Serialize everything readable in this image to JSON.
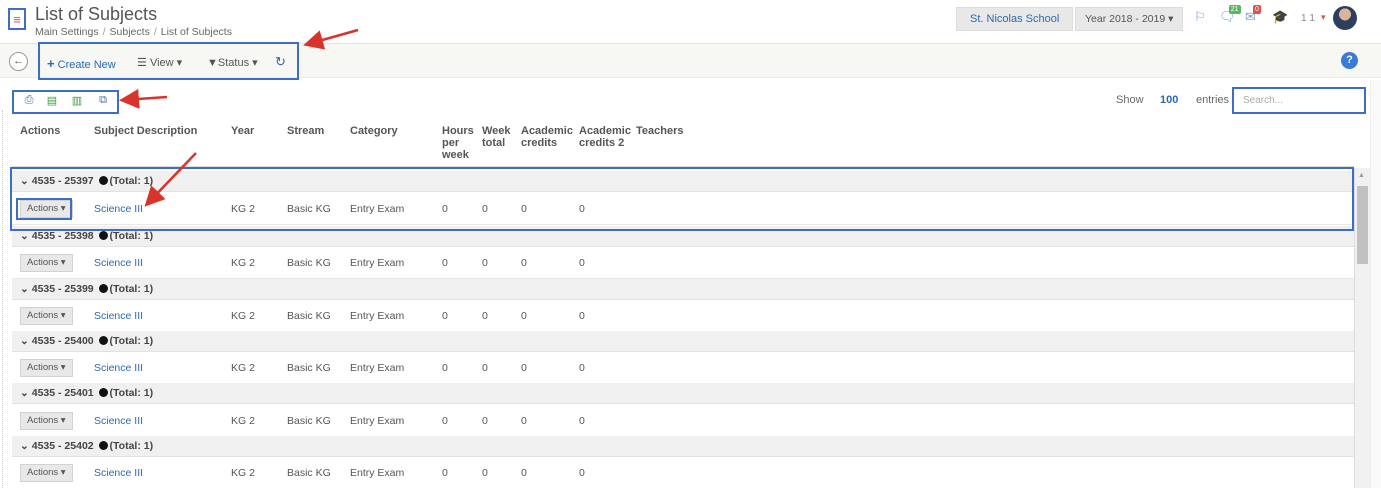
{
  "header": {
    "menu_icon": "hamburger-icon",
    "title": "List of Subjects",
    "breadcrumb": [
      "Main Settings",
      "Subjects",
      "List of Subjects"
    ],
    "school": "St. Nicolas School",
    "year": "Year 2018 - 2019",
    "notifications": {
      "messages_badge": "21",
      "mail_badge": "0"
    },
    "user_count": "1 1"
  },
  "toolbar": {
    "create_new": "Create New",
    "view": "View",
    "status": "Status",
    "help": "?"
  },
  "table_controls": {
    "show_label": "Show",
    "show_value": "100",
    "entries_label": "entries",
    "search_placeholder": "Search..."
  },
  "columns": [
    "Actions",
    "Subject Description",
    "Year",
    "Stream",
    "Category",
    "Hours per week",
    "Week total",
    "Academic credits",
    "Academic credits 2",
    "Teachers"
  ],
  "column_lines": {
    "hours": [
      "Hours",
      "per",
      "week"
    ],
    "week_total": [
      "Week",
      "total"
    ],
    "academic_credits": [
      "Academic",
      "credits"
    ],
    "academic_credits_2": [
      "Academic",
      "credits 2"
    ]
  },
  "groups": [
    {
      "label": "4535 - 25397",
      "total": "(Total: 1)",
      "row": {
        "actions": "Actions",
        "subject": "Science III",
        "year": "KG 2",
        "stream": "Basic KG",
        "category": "Entry Exam",
        "hours": "0",
        "week_total": "0",
        "credits": "0",
        "credits2": "0"
      }
    },
    {
      "label": "4535 - 25398",
      "total": "(Total: 1)",
      "row": {
        "actions": "Actions",
        "subject": "Science III",
        "year": "KG 2",
        "stream": "Basic KG",
        "category": "Entry Exam",
        "hours": "0",
        "week_total": "0",
        "credits": "0",
        "credits2": "0"
      }
    },
    {
      "label": "4535 - 25399",
      "total": "(Total: 1)",
      "row": {
        "actions": "Actions",
        "subject": "Science III",
        "year": "KG 2",
        "stream": "Basic KG",
        "category": "Entry Exam",
        "hours": "0",
        "week_total": "0",
        "credits": "0",
        "credits2": "0"
      }
    },
    {
      "label": "4535 - 25400",
      "total": "(Total: 1)",
      "row": {
        "actions": "Actions",
        "subject": "Science III",
        "year": "KG 2",
        "stream": "Basic KG",
        "category": "Entry Exam",
        "hours": "0",
        "week_total": "0",
        "credits": "0",
        "credits2": "0"
      }
    },
    {
      "label": "4535 - 25401",
      "total": "(Total: 1)",
      "row": {
        "actions": "Actions",
        "subject": "Science III",
        "year": "KG 2",
        "stream": "Basic KG",
        "category": "Entry Exam",
        "hours": "0",
        "week_total": "0",
        "credits": "0",
        "credits2": "0"
      }
    },
    {
      "label": "4535 - 25402",
      "total": "(Total: 1)",
      "row": {
        "actions": "Actions",
        "subject": "Science III",
        "year": "KG 2",
        "stream": "Basic KG",
        "category": "Entry Exam",
        "hours": "0",
        "week_total": "0",
        "credits": "0",
        "credits2": "0"
      }
    }
  ],
  "colors": {
    "accent": "#2a6ab5",
    "annotation_box": "#3d6cc9",
    "annotation_arrow": "#d9342b",
    "menu_icon": "#d9534f"
  }
}
